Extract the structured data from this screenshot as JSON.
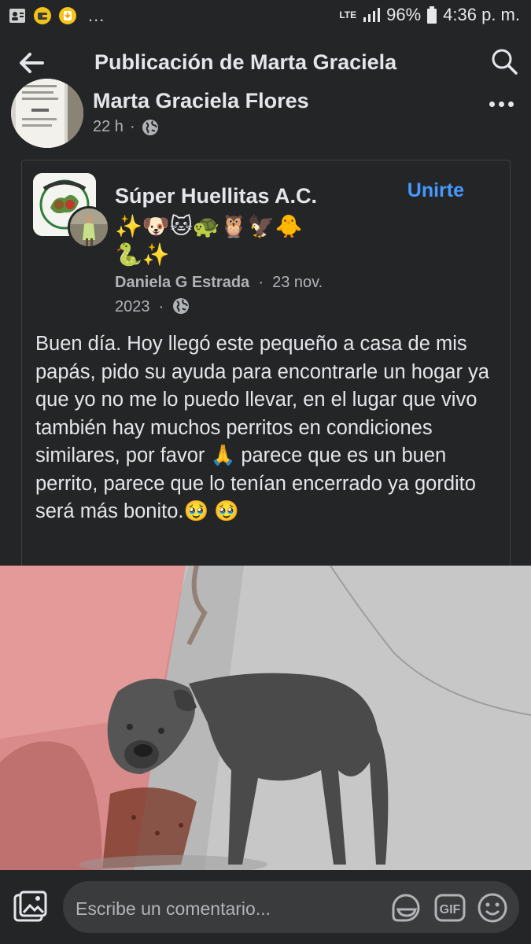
{
  "status_bar": {
    "network": "LTE",
    "battery": "96%",
    "time": "4:36 p. m.",
    "overflow": "..."
  },
  "header": {
    "title": "Publicación de Marta Graciela",
    "icons": [
      "back-arrow-icon",
      "search-icon"
    ]
  },
  "post": {
    "author": "Marta Graciela Flores",
    "time": "22 h",
    "separator": "·",
    "audience_icon": "globe-icon"
  },
  "shared_post": {
    "group_name": "Súper Huellitas A.C.",
    "join_label": "Unirte",
    "emojis_line1": "✨🐶🐱🐢🦉🦅🐥",
    "emojis_line2": "🐍✨",
    "poster": "Daniela G Estrada",
    "date_line1": "23 nov.",
    "date_line2": "2023",
    "separator": "·",
    "text": "Buen día. Hoy llegó este pequeño a casa de mis papás, pido su ayuda para encontrarle un hogar ya que yo no me lo puedo llevar, en el lugar que vivo también hay muchos perritos en condiciones similares, por favor 🙏 parece que es un buen perrito, parece que lo tenían encerrado ya gordito será más bonito.🥹 🥹",
    "colors": {
      "link": "#4599ff"
    }
  },
  "comment_bar": {
    "placeholder": "Escribe un comentario...",
    "gif_label": "GIF",
    "icons": [
      "photo-icon",
      "sticker-icon",
      "gif-icon",
      "emoji-icon"
    ]
  }
}
